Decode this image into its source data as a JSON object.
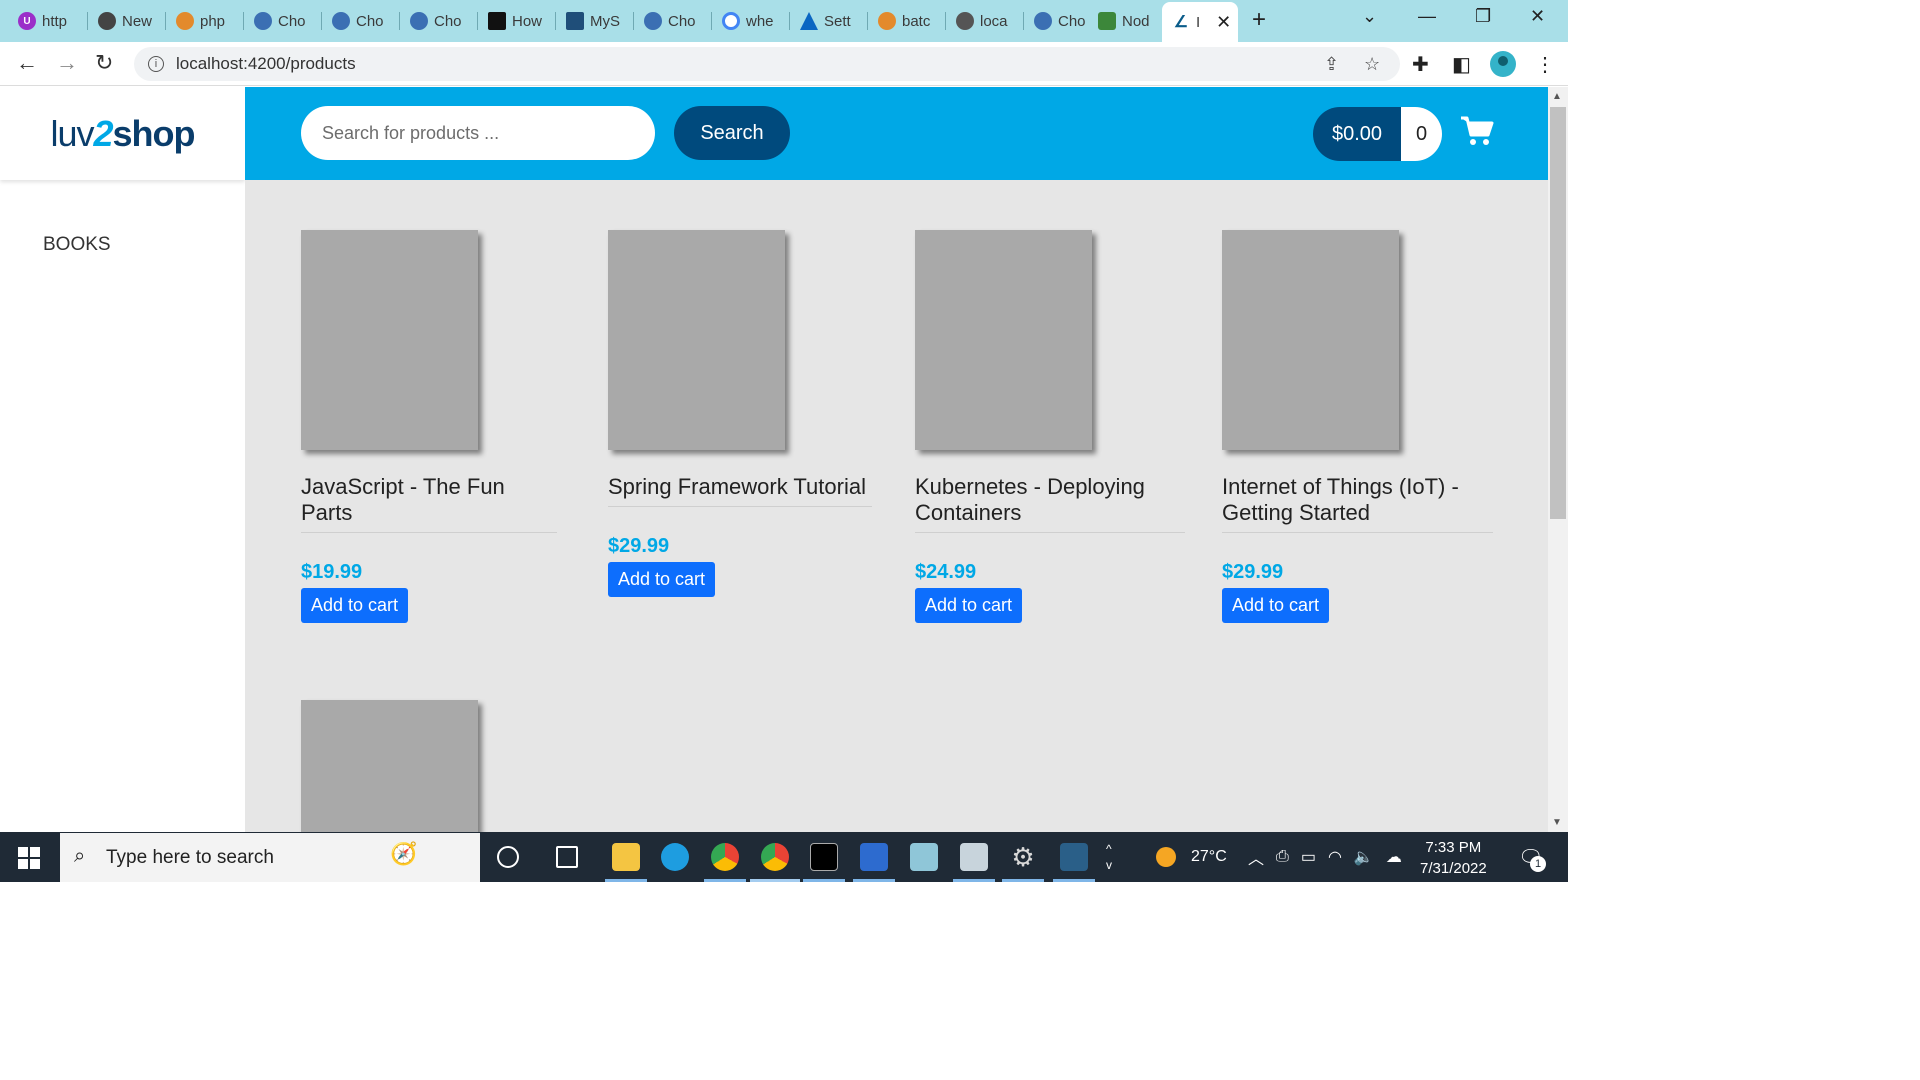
{
  "browser": {
    "tabs": [
      {
        "label": "http",
        "color": "#9b2fc9"
      },
      {
        "label": "New",
        "color": "#444444"
      },
      {
        "label": "php",
        "color": "#e38a2c"
      },
      {
        "label": "Cho",
        "color": "#3b6fb3"
      },
      {
        "label": "Cho",
        "color": "#3b6fb3"
      },
      {
        "label": "Cho",
        "color": "#3b6fb3"
      },
      {
        "label": "How",
        "color": "#111111"
      },
      {
        "label": "MyS",
        "color": "#1f4e79"
      },
      {
        "label": "Cho",
        "color": "#3b6fb3"
      },
      {
        "label": "whe",
        "color": "#4285f4"
      },
      {
        "label": "Sett",
        "color": "#0a66c2"
      },
      {
        "label": "batc",
        "color": "#e38a2c"
      },
      {
        "label": "loca",
        "color": "#555555"
      },
      {
        "label": "Cho",
        "color": "#3b6fb3"
      },
      {
        "label": "Nod",
        "color": "#3c873a"
      },
      {
        "label": "I",
        "color": "#0a5c8a"
      }
    ],
    "new_tab": "+",
    "url": "localhost:4200/products"
  },
  "sidebar": {
    "logo_part1": "luv",
    "logo_part2": "2",
    "logo_part3": "shop",
    "category": "BOOKS"
  },
  "header": {
    "search_placeholder": "Search for products ...",
    "search_button": "Search",
    "cart_total": "$0.00",
    "cart_quantity": "0"
  },
  "products": [
    {
      "name": "JavaScript - The Fun Parts",
      "price": "$19.99",
      "button": "Add to cart"
    },
    {
      "name": "Spring Framework Tutorial",
      "price": "$29.99",
      "button": "Add to cart"
    },
    {
      "name": "Kubernetes - Deploying Containers",
      "price": "$24.99",
      "button": "Add to cart"
    },
    {
      "name": "Internet of Things (IoT) - Getting Started",
      "price": "$29.99",
      "button": "Add to cart"
    }
  ],
  "taskbar": {
    "search_placeholder": "Type here to search",
    "temperature": "27°C",
    "time": "7:33 PM",
    "date": "7/31/2022",
    "notification_count": "1"
  },
  "colors": {
    "header_bg": "#00a8e6",
    "dark_blue": "#004a7d",
    "price": "#00a8e6",
    "add_to_cart": "#0d6efd",
    "content_bg": "#e6e6e6"
  }
}
